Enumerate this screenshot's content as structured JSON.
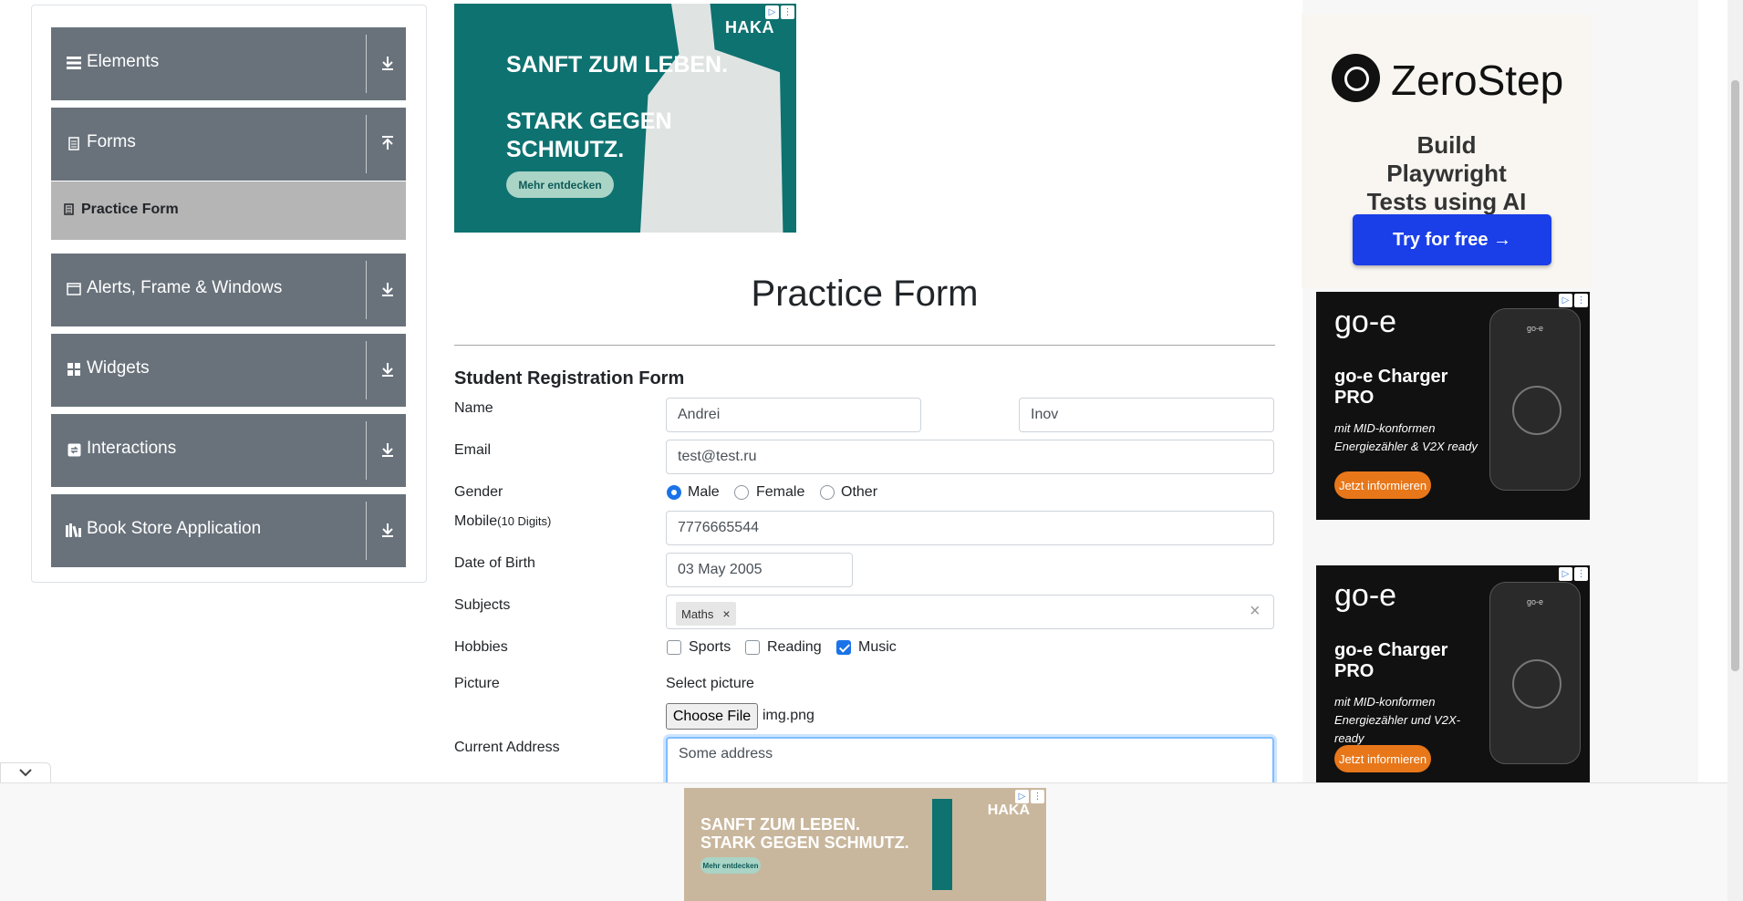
{
  "sidebar": {
    "groups": [
      {
        "label": "Elements",
        "icon": "hamburger-icon"
      },
      {
        "label": "Forms",
        "icon": "form-icon"
      },
      {
        "label": "Alerts, Frame & Windows",
        "icon": "window-icon"
      },
      {
        "label": "Widgets",
        "icon": "widgets-icon"
      },
      {
        "label": "Interactions",
        "icon": "interactions-icon"
      },
      {
        "label": "Book Store Application",
        "icon": "books-icon"
      }
    ],
    "active_item": "Practice Form"
  },
  "ads": {
    "top": {
      "headline1": "SANFT ZUM LEBEN.",
      "headline2": "STARK GEGEN SCHMUTZ.",
      "brand": "HAKA",
      "button": "Mehr entdecken"
    },
    "zerostep": {
      "name": "ZeroStep",
      "tagline": "Build Playwright Tests using AI",
      "button": "Try for free →"
    },
    "goe": {
      "logo": "go-e",
      "name": "go-e Charger PRO",
      "sub1": "mit MID-konformen Energiezähler & V2X ready",
      "sub2": "mit MID-konformen Energiezähler und V2X-ready",
      "button": "Jetzt informieren",
      "device_text": "go-e"
    },
    "bottom": {
      "headline": "SANFT ZUM LEBEN. STARK GEGEN SCHMUTZ.",
      "button": "Mehr entdecken",
      "brand": "HAKA"
    }
  },
  "page": {
    "title": "Practice Form",
    "form_title": "Student Registration Form"
  },
  "form": {
    "name_label": "Name",
    "first_name": "Andrei",
    "last_name": "Inov",
    "email_label": "Email",
    "email": "test@test.ru",
    "gender_label": "Gender",
    "genders": [
      "Male",
      "Female",
      "Other"
    ],
    "gender_selected": "Male",
    "mobile_label": "Mobile",
    "mobile_hint": "(10 Digits)",
    "mobile": "7776665544",
    "dob_label": "Date of Birth",
    "dob": "03 May 2005",
    "subjects_label": "Subjects",
    "subjects": [
      "Maths"
    ],
    "subject_remove": "×",
    "subjects_clear": "×",
    "hobbies_label": "Hobbies",
    "hobbies": [
      "Sports",
      "Reading",
      "Music"
    ],
    "hobbies_checked": [
      "Music"
    ],
    "picture_label": "Picture",
    "select_picture": "Select picture",
    "choose_file": "Choose File",
    "file_name": "img.png",
    "address_label": "Current Address",
    "address": "Some address"
  },
  "adchoices": {
    "play": "▷",
    "close": "⋮"
  }
}
